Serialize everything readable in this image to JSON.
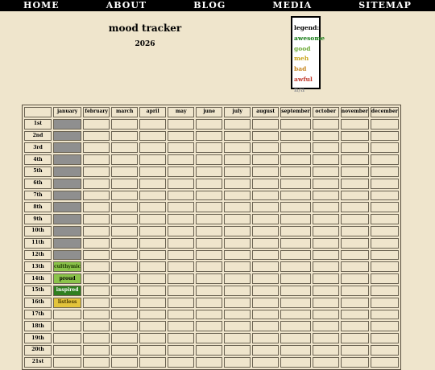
{
  "nav": [
    "HOME",
    "ABOUT",
    "BLOG",
    "MEDIA",
    "SITEMAP"
  ],
  "title": "mood tracker",
  "year": "2026",
  "legend": {
    "heading": "legend:",
    "items": [
      {
        "label": "awesome",
        "color": "#137a13"
      },
      {
        "label": "good",
        "color": "#6aa832"
      },
      {
        "label": "meh",
        "color": "#c9a51b"
      },
      {
        "label": "bad",
        "color": "#c7851c"
      },
      {
        "label": "awful",
        "color": "#c0392b"
      },
      {
        "label": "n/a",
        "color": "#9a9a9a"
      }
    ]
  },
  "table": {
    "months": [
      "january",
      "february",
      "march",
      "april",
      "may",
      "june",
      "july",
      "august",
      "september",
      "october",
      "november",
      "december"
    ],
    "days": [
      "1st",
      "2nd",
      "3rd",
      "4th",
      "5th",
      "6th",
      "7th",
      "8th",
      "9th",
      "10th",
      "11th",
      "12th",
      "13th",
      "14th",
      "15th",
      "16th",
      "17th",
      "18th",
      "19th",
      "20th",
      "21st"
    ],
    "january_entries": [
      {
        "day": "1st",
        "mood": "",
        "style": "filled"
      },
      {
        "day": "2nd",
        "mood": "",
        "style": "filled"
      },
      {
        "day": "3rd",
        "mood": "",
        "style": "filled"
      },
      {
        "day": "4th",
        "mood": "",
        "style": "filled"
      },
      {
        "day": "5th",
        "mood": "",
        "style": "filled"
      },
      {
        "day": "6th",
        "mood": "",
        "style": "filled"
      },
      {
        "day": "7th",
        "mood": "",
        "style": "filled"
      },
      {
        "day": "8th",
        "mood": "",
        "style": "filled"
      },
      {
        "day": "9th",
        "mood": "",
        "style": "filled"
      },
      {
        "day": "10th",
        "mood": "",
        "style": "filled"
      },
      {
        "day": "11th",
        "mood": "",
        "style": "filled"
      },
      {
        "day": "12th",
        "mood": "",
        "style": "filled"
      },
      {
        "day": "13th",
        "mood": "culthymic",
        "style": "m-culthymic"
      },
      {
        "day": "14th",
        "mood": "proud",
        "style": "m-proud"
      },
      {
        "day": "15th",
        "mood": "inspired",
        "style": "m-inspired"
      },
      {
        "day": "16th",
        "mood": "listless",
        "style": "m-listless"
      }
    ]
  }
}
